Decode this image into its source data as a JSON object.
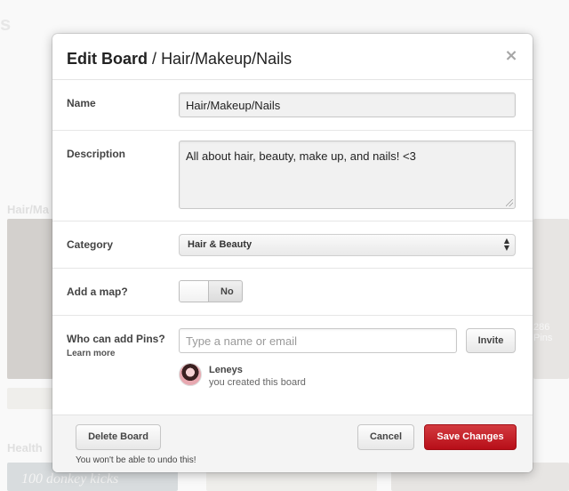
{
  "modal": {
    "title": "Edit Board",
    "separator": "/",
    "board_name": "Hair/Makeup/Nails",
    "close_glyph": "×"
  },
  "fields": {
    "name": {
      "label": "Name",
      "value": "Hair/Makeup/Nails"
    },
    "description": {
      "label": "Description",
      "value": "All about hair, beauty, make up, and nails! <3"
    },
    "category": {
      "label": "Category",
      "value": "Hair & Beauty"
    },
    "map": {
      "label": "Add a map?",
      "toggle_state": "No"
    },
    "collaborators": {
      "label": "Who can add Pins?",
      "learn_more": "Learn more",
      "placeholder": "Type a name or email",
      "invite_label": "Invite",
      "creator_name": "Leneys",
      "creator_note": "you created this board"
    }
  },
  "footer": {
    "delete_label": "Delete Board",
    "warning": "You won't be able to undo this!",
    "cancel_label": "Cancel",
    "save_label": "Save Changes"
  },
  "icons": {
    "close": "close-icon",
    "select_arrows": "select-arrows-icon",
    "avatar": "user-avatar"
  },
  "colors": {
    "primary_button": "#c1121f",
    "overlay": "#ffffff",
    "input_bg": "#f1f1f1"
  }
}
